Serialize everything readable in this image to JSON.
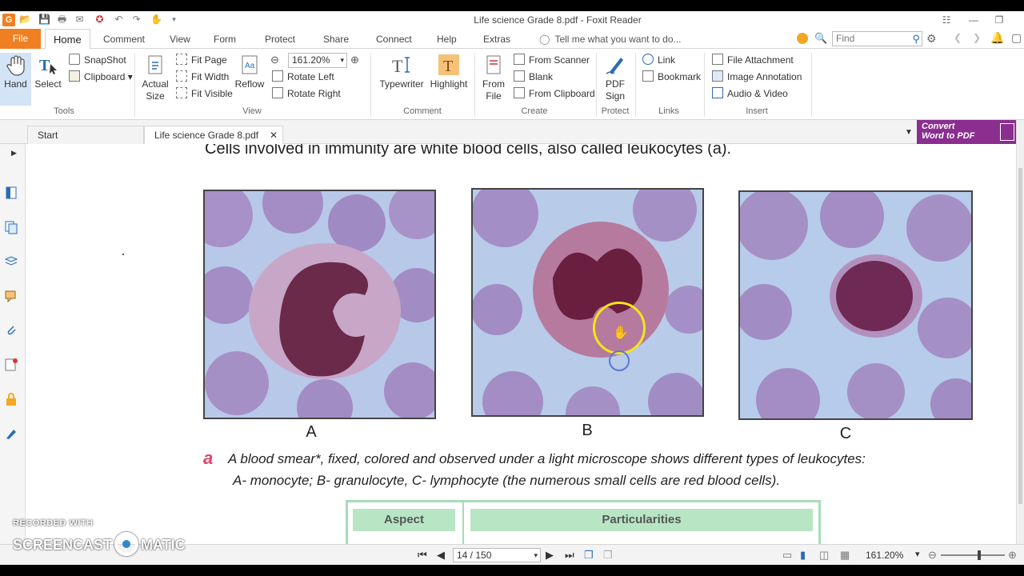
{
  "window": {
    "title": "Life science Grade 8.pdf - Foxit Reader",
    "logo": "G"
  },
  "menu": {
    "file": "File",
    "tabs": [
      "Home",
      "Comment",
      "View",
      "Form",
      "Protect",
      "Share",
      "Connect",
      "Help",
      "Extras"
    ],
    "tell_me": "Tell me what you want to do...",
    "find_placeholder": "Find"
  },
  "ribbon": {
    "tools": {
      "hand": "Hand",
      "select": "Select",
      "snapshot": "SnapShot",
      "clipboard": "Clipboard",
      "label": "Tools"
    },
    "view": {
      "actual_size_1": "Actual",
      "actual_size_2": "Size",
      "fit_page": "Fit Page",
      "fit_width": "Fit Width",
      "fit_visible": "Fit Visible",
      "reflow": "Reflow",
      "zoom": "161.20%",
      "rotate_left": "Rotate Left",
      "rotate_right": "Rotate Right",
      "label": "View"
    },
    "comment": {
      "typewriter": "Typewriter",
      "highlight": "Highlight",
      "label": "Comment"
    },
    "create": {
      "from_file_1": "From",
      "from_file_2": "File",
      "from_scanner": "From Scanner",
      "blank": "Blank",
      "from_clipboard": "From Clipboard",
      "label": "Create"
    },
    "protect": {
      "pdf_sign_1": "PDF",
      "pdf_sign_2": "Sign",
      "label": "Protect"
    },
    "links": {
      "link": "Link",
      "bookmark": "Bookmark",
      "label": "Links"
    },
    "insert": {
      "file_attachment": "File Attachment",
      "image_annotation": "Image Annotation",
      "audio_video": "Audio & Video",
      "label": "Insert"
    }
  },
  "tabs": {
    "start": "Start",
    "current": "Life science Grade 8.pdf"
  },
  "convert": {
    "line1": "Convert",
    "line2": "Word to PDF"
  },
  "page": {
    "top_text": "Cells involved in immunity are white blood cells, also called leukocytes (a).",
    "labels": [
      "A",
      "B",
      "C"
    ],
    "caption_marker": "a",
    "caption_line1": "A blood smear*, fixed, colored and observed under a light microscope shows different types of leukocytes:",
    "caption_line2": "A- monocyte; B- granulocyte, C- lymphocyte (the numerous small cells are red blood cells).",
    "table_headers": [
      "Aspect",
      "Particularities"
    ]
  },
  "status": {
    "page": "14 / 150",
    "zoom": "161.20%",
    "zoom_level": 0.6
  },
  "watermark": {
    "line1": "RECORDED WITH",
    "line2a": "SCREENCAST",
    "line2b": "MATIC"
  },
  "colors": {
    "accent": "#f07f22",
    "convert": "#8a2e8f",
    "table_green": "#b8e6c4"
  }
}
